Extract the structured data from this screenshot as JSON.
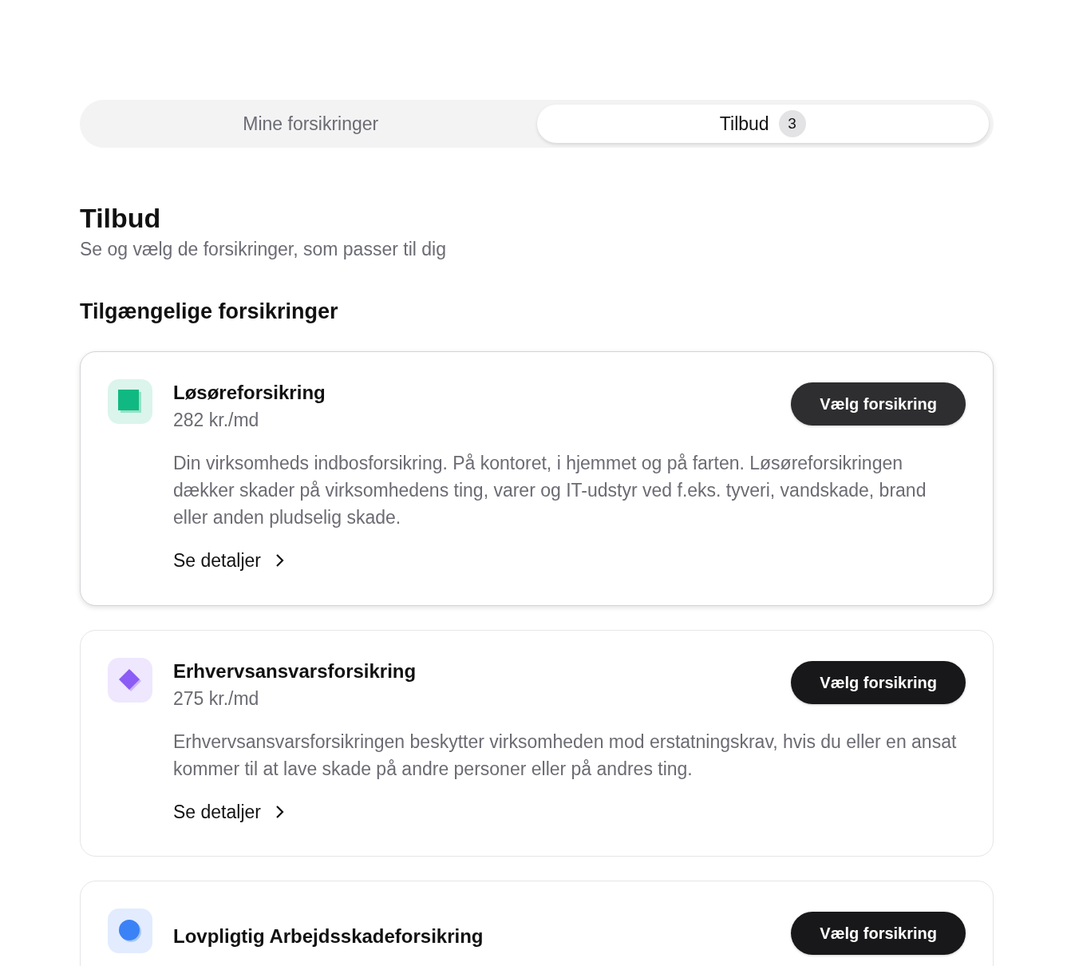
{
  "tabs": [
    {
      "label": "Mine forsikringer",
      "selected": false
    },
    {
      "label": "Tilbud",
      "selected": true,
      "count": "3"
    }
  ],
  "header": {
    "title": "Tilbud",
    "subtitle": "Se og vælg de forsikringer, som passer til dig"
  },
  "section_title": "Tilgængelige forsikringer",
  "offers": [
    {
      "name": "Løsøreforsikring",
      "price": "282 kr./md",
      "kind": "square",
      "color": "#10b981",
      "highlighted": true,
      "description": "Din virksomheds indbosforsikring. På kontoret, i hjemmet og på farten. Løsøreforsikringen dækker skader på virksomhedens ting, varer og IT-udstyr ved f.eks. tyveri, vandskade, brand eller anden pludselig skade.",
      "link": "Se detaljer",
      "button": "Vælg forsikring"
    },
    {
      "name": "Erhvervsansvarsforsikring",
      "price": "275 kr./md",
      "kind": "diamond",
      "color": "#8b5cf6",
      "highlighted": false,
      "description": "Erhvervsansvarsforsikringen beskytter virksomheden mod erstatningskrav, hvis du eller en ansat kommer til at lave skade på andre personer eller på andres ting.",
      "link": "Se detaljer",
      "button": "Vælg forsikring"
    },
    {
      "name": "Lovpligtig Arbejdsskadeforsikring",
      "kind": "circle",
      "color": "#3b82f6",
      "highlighted": false,
      "button": "Vælg forsikring"
    }
  ]
}
